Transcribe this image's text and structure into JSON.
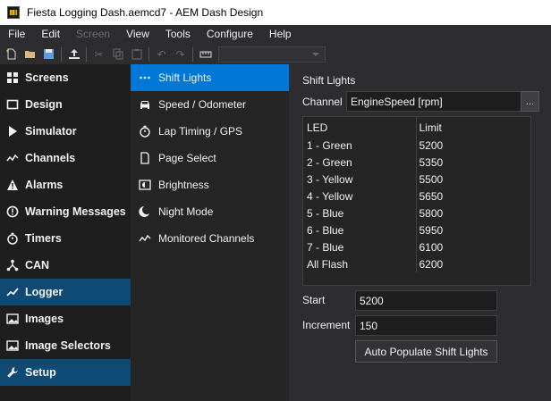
{
  "window": {
    "title": "Fiesta Logging Dash.aemcd7 - AEM Dash Design"
  },
  "menu": [
    "File",
    "Edit",
    "Screen",
    "View",
    "Tools",
    "Configure",
    "Help"
  ],
  "nav": [
    {
      "label": "Screens",
      "icon": "grid-icon"
    },
    {
      "label": "Design",
      "icon": "square-icon"
    },
    {
      "label": "Simulator",
      "icon": "play-icon"
    },
    {
      "label": "Channels",
      "icon": "wave-icon"
    },
    {
      "label": "Alarms",
      "icon": "warning-triangle-icon"
    },
    {
      "label": "Warning Messages",
      "icon": "exclamation-circle-icon"
    },
    {
      "label": "Timers",
      "icon": "stopwatch-icon"
    },
    {
      "label": "CAN",
      "icon": "network-icon"
    },
    {
      "label": "Logger",
      "icon": "line-chart-icon"
    },
    {
      "label": "Images",
      "icon": "image-icon"
    },
    {
      "label": "Image Selectors",
      "icon": "image-selector-icon"
    },
    {
      "label": "Setup",
      "icon": "wrench-icon"
    }
  ],
  "subnav": [
    {
      "label": "Shift Lights",
      "icon": "dots-icon"
    },
    {
      "label": "Speed / Odometer",
      "icon": "car-icon"
    },
    {
      "label": "Lap Timing / GPS",
      "icon": "stopwatch-icon"
    },
    {
      "label": "Page Select",
      "icon": "page-icon"
    },
    {
      "label": "Brightness",
      "icon": "brightness-icon"
    },
    {
      "label": "Night Mode",
      "icon": "moon-icon"
    },
    {
      "label": "Monitored Channels",
      "icon": "wave-icon"
    }
  ],
  "main": {
    "section_title": "Shift Lights",
    "channel_label": "Channel",
    "channel_value": "EngineSpeed [rpm]",
    "browse_label": "...",
    "table": {
      "headers": [
        "LED",
        "Limit"
      ],
      "rows": [
        [
          "1 - Green",
          "5200"
        ],
        [
          "2 - Green",
          "5350"
        ],
        [
          "3 - Yellow",
          "5500"
        ],
        [
          "4 - Yellow",
          "5650"
        ],
        [
          "5 - Blue",
          "5800"
        ],
        [
          "6 - Blue",
          "5950"
        ],
        [
          "7 - Blue",
          "6100"
        ],
        [
          "All Flash",
          "6200"
        ]
      ]
    },
    "start_label": "Start",
    "start_value": "5200",
    "increment_label": "Increment",
    "increment_value": "150",
    "auto_button": "Auto Populate Shift Lights"
  },
  "colors": {
    "active_nav": "#0e4a73",
    "active_subnav": "#0078d7",
    "background": "#2d2d30"
  }
}
